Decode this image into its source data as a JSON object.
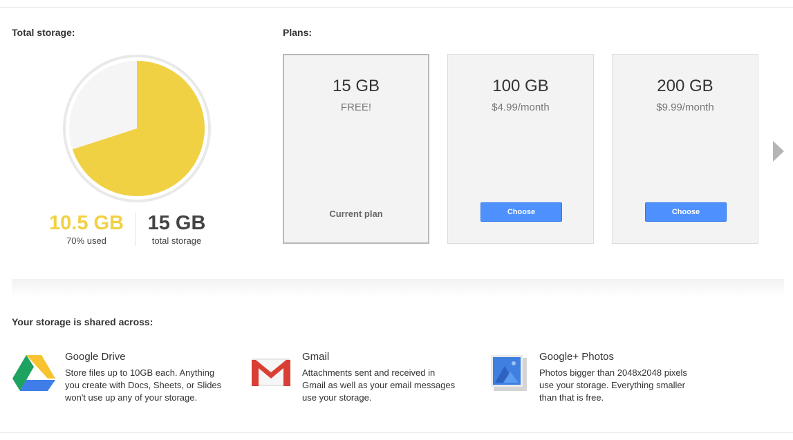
{
  "storage": {
    "label": "Total storage:",
    "used_value": "10.5 GB",
    "used_caption": "70% used",
    "total_value": "15 GB",
    "total_caption": "total storage",
    "used_fraction": 0.7,
    "colors": {
      "used": "#f1d144",
      "free": "#f5f5f5"
    }
  },
  "plans": {
    "label": "Plans:",
    "items": [
      {
        "size": "15 GB",
        "price": "FREE!",
        "current_label": "Current plan"
      },
      {
        "size": "100 GB",
        "price": "$4.99/month",
        "button": "Choose"
      },
      {
        "size": "200 GB",
        "price": "$9.99/month",
        "button": "Choose"
      }
    ]
  },
  "shared": {
    "label": "Your storage is shared across:",
    "services": [
      {
        "name": "Google Drive",
        "icon": "google-drive-icon",
        "lines": [
          "Store files up to 10GB each. Anything",
          "you create with Docs, Sheets, or Slides",
          "won't use up any of your storage."
        ]
      },
      {
        "name": "Gmail",
        "icon": "gmail-icon",
        "lines": [
          "Attachments sent and received in",
          "Gmail as well as your email messages",
          "use your storage."
        ]
      },
      {
        "name": "Google+ Photos",
        "icon": "google-photos-icon",
        "lines": [
          "Photos bigger than 2048x2048 pixels",
          "use your storage. Everything smaller",
          "than that is free."
        ]
      }
    ]
  }
}
